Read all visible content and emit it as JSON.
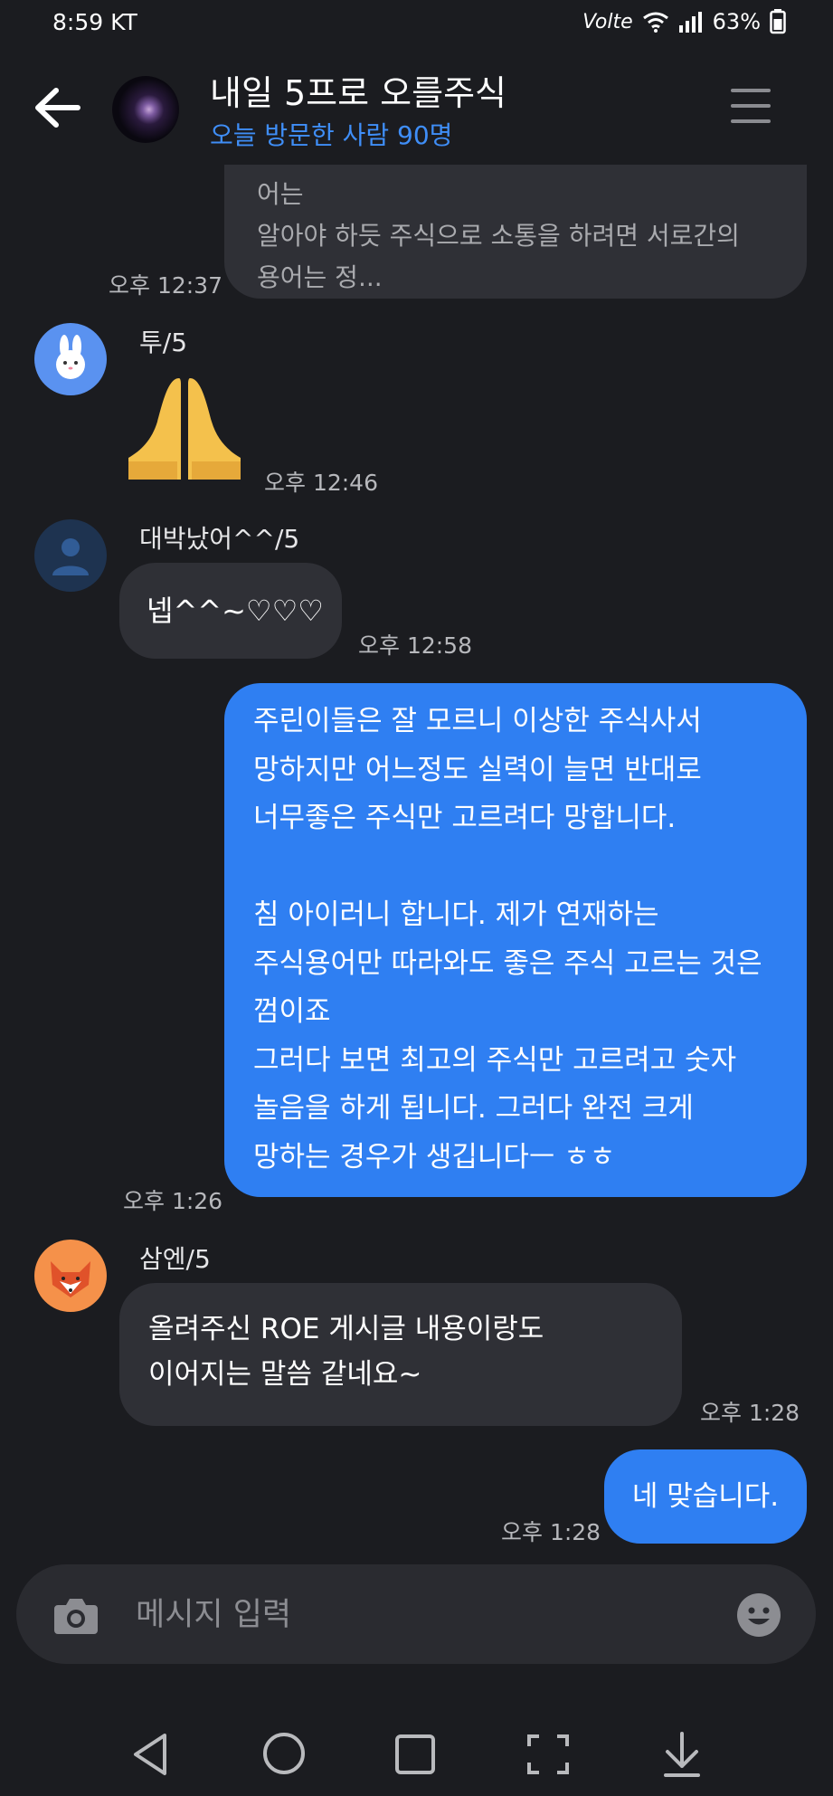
{
  "status_bar": {
    "time": "8:59 KT",
    "network": "Volte",
    "battery": "63%"
  },
  "header": {
    "title": "내일 5프로 오를주식",
    "subtitle": "오늘 방문한 사람 90명",
    "icons": [
      "back-arrow-icon",
      "menu-icon"
    ]
  },
  "messages": [
    {
      "type": "incoming",
      "partial": true,
      "text": "…이가 정의도 에의를 위해는 최소의 규칙 및 용어는\n알아야 하듯 주식으로 소통을 하려면 서로간의\n용어는 정...",
      "time": "오후 12:37"
    },
    {
      "type": "incoming",
      "sender": "투/5",
      "content": "folded-hands-emoji",
      "time": "오후 12:46"
    },
    {
      "type": "incoming",
      "sender": "대박났어^^/5",
      "text": "넵^^~♡♡♡",
      "time": "오후 12:58"
    },
    {
      "type": "outgoing",
      "text": "주린이들은 잘 모르니 이상한 주식사서\n망하지만 어느정도 실력이 늘면 반대로\n너무좋은 주식만 고르려다 망합니다.\n\n침 아이러니 합니다. 제가 연재하는\n주식용어만 따라와도 좋은 주식 고르는 것은\n껌이죠\n 그러다 보면 최고의 주식만 고르려고 숫자\n놀음을 하게 됩니다. 그러다 완전 크게\n망하는 경우가 생깁니다ㅡ ㅎㅎ",
      "time": "오후 1:26"
    },
    {
      "type": "incoming",
      "sender": "삼엔/5",
      "text": "올려주신 ROE 게시글 내용이랑도\n이어지는 말씀 같네요~",
      "time": "오후 1:28"
    },
    {
      "type": "outgoing",
      "text": "네 맞습니다.",
      "time": "오후 1:28"
    }
  ],
  "composer": {
    "placeholder": "메시지 입력",
    "icons": [
      "camera-icon",
      "emoji-icon"
    ]
  },
  "nav_bar": {
    "icons": [
      "nav-back-icon",
      "nav-home-icon",
      "nav-recents-icon",
      "nav-screenshot-icon",
      "nav-download-icon"
    ]
  },
  "colors": {
    "background": "#1b1c20",
    "bubble_in": "#2f3036",
    "bubble_out": "#2f7ff2",
    "accent": "#3f8ef7"
  }
}
